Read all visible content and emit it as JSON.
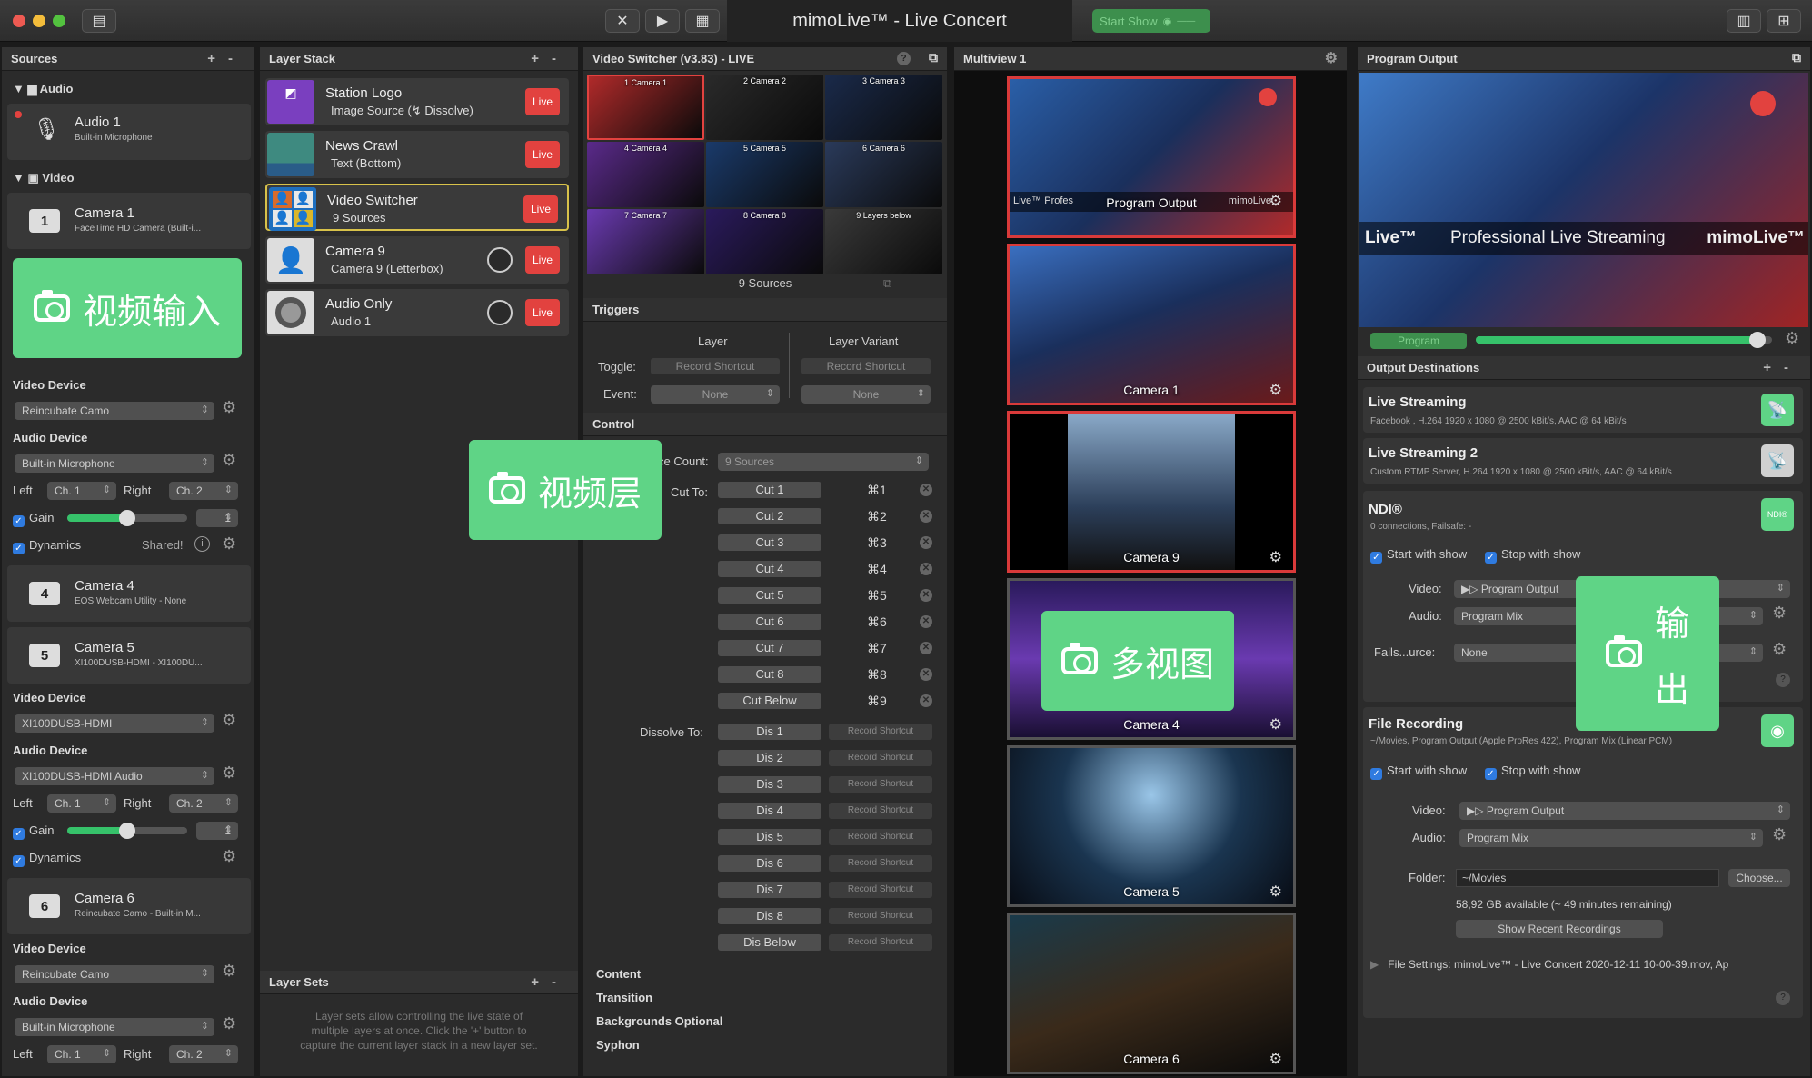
{
  "window": {
    "title": "mimoLive™ - Live Concert",
    "start_show": "Start Show"
  },
  "colors": {
    "live_red": "#e2423f",
    "green_accent": "#5fd486",
    "panel_bg": "#2b2b2b"
  },
  "sources": {
    "title": "Sources",
    "add": "+",
    "remove": "-",
    "audio_group": "Audio",
    "video_group": "Video",
    "audio1": {
      "name": "Audio 1",
      "sub": "Built-in Microphone"
    },
    "camera1": {
      "num": "1",
      "name": "Camera 1",
      "sub": "FaceTime HD Camera (Built-i..."
    },
    "camera4": {
      "num": "4",
      "name": "Camera 4",
      "sub": "EOS Webcam Utility - None"
    },
    "camera5": {
      "num": "5",
      "name": "Camera 5",
      "sub": "XI100DUSB-HDMI - XI100DU..."
    },
    "camera6": {
      "num": "6",
      "name": "Camera 6",
      "sub": "Reincubate Camo - Built-in M..."
    },
    "video_device_label": "Video Device",
    "audio_device_label": "Audio Device",
    "block1": {
      "video_device": "Reincubate Camo",
      "audio_device": "Built-in Microphone",
      "left": "Left",
      "left_ch": "Ch. 1",
      "right": "Right",
      "right_ch": "Ch. 2",
      "gain": "Gain",
      "gain_value": "1",
      "gain_level": 0.5,
      "dynamics": "Dynamics",
      "shared": "Shared!"
    },
    "block2": {
      "video_device": "XI100DUSB-HDMI",
      "audio_device": "XI100DUSB-HDMI Audio",
      "left": "Left",
      "left_ch": "Ch. 1",
      "right": "Right",
      "right_ch": "Ch. 2",
      "gain": "Gain",
      "gain_value": "1",
      "gain_level": 0.5,
      "dynamics": "Dynamics"
    },
    "block3": {
      "video_device": "Reincubate Camo",
      "audio_device": "Built-in Microphone",
      "left": "Left",
      "left_ch": "Ch. 1",
      "right": "Right",
      "right_ch": "Ch. 2"
    }
  },
  "overlays": {
    "video_input": "视频输入",
    "video_layer": "视频层",
    "multiview": "多视图",
    "output_1": "输",
    "output_2": "出"
  },
  "layer_stack": {
    "title": "Layer Stack",
    "add": "+",
    "remove": "-",
    "layers": [
      {
        "name": "Station Logo",
        "sub": "Image Source (↯ Dissolve)",
        "live": "Live"
      },
      {
        "name": "News Crawl",
        "sub": "Text (Bottom)",
        "live": "Live"
      },
      {
        "name": "Video Switcher",
        "sub": "9 Sources",
        "live": "Live"
      },
      {
        "name": "Camera 9",
        "sub": "Camera 9 (Letterbox)",
        "live": "Live"
      },
      {
        "name": "Audio Only",
        "sub": "Audio 1",
        "live": "Live"
      }
    ],
    "layer_sets_title": "Layer Sets",
    "layer_sets_help": "Layer sets allow controlling the live state of multiple layers at once. Click the '+' button to capture the current layer stack in a new layer set."
  },
  "switcher": {
    "title": "Video Switcher (v3.83) - LIVE",
    "cams": [
      "1 Camera 1",
      "2 Camera 2",
      "3 Camera 3",
      "4 Camera 4",
      "5 Camera 5",
      "6 Camera 6",
      "7 Camera 7",
      "8 Camera 8",
      "9 Layers below"
    ],
    "sources_count": "9 Sources",
    "triggers": "Triggers",
    "layer_col": "Layer",
    "variant_col": "Layer Variant",
    "toggle": "Toggle:",
    "event": "Event:",
    "record_shortcut": "Record Shortcut",
    "none": "None",
    "control": "Control",
    "source_count_label": "ce Count:",
    "source_count_value": "9 Sources",
    "cut_to": "Cut To:",
    "dissolve_to": "Dissolve To:",
    "cuts": [
      {
        "label": "Cut 1",
        "key": "⌘1"
      },
      {
        "label": "Cut 2",
        "key": "⌘2"
      },
      {
        "label": "Cut 3",
        "key": "⌘3"
      },
      {
        "label": "Cut 4",
        "key": "⌘4"
      },
      {
        "label": "Cut 5",
        "key": "⌘5"
      },
      {
        "label": "Cut 6",
        "key": "⌘6"
      },
      {
        "label": "Cut 7",
        "key": "⌘7"
      },
      {
        "label": "Cut 8",
        "key": "⌘8"
      },
      {
        "label": "Cut Below",
        "key": "⌘9"
      }
    ],
    "dissolves": [
      "Dis 1",
      "Dis 2",
      "Dis 3",
      "Dis 4",
      "Dis 5",
      "Dis 6",
      "Dis 7",
      "Dis 8",
      "Dis Below"
    ],
    "bottom": [
      "Content",
      "Transition",
      "Backgrounds Optional",
      "Syphon"
    ]
  },
  "multiview": {
    "title": "Multiview 1",
    "tiles": [
      "Program Output",
      "Camera 1",
      "Camera 9",
      "Camera 4",
      "Camera 5",
      "Camera 6"
    ],
    "ticker": "Live™   Profes",
    "ticker_right": "mimoLive"
  },
  "program": {
    "title": "Program Output",
    "ticker_left": "Live™",
    "ticker_mid": "Professional Live Streaming",
    "ticker_right": "mimoLive™",
    "program_btn": "Program",
    "program_level": 0.95,
    "dest_title": "Output Destinations",
    "live1": {
      "title": "Live Streaming",
      "sub": "Facebook                                         , H.264 1920 x 1080 @ 2500 kBit/s, AAC @ 64 kBit/s"
    },
    "live2": {
      "title": "Live Streaming 2",
      "sub": "Custom RTMP Server, H.264 1920 x 1080 @ 2500 kBit/s, AAC @ 64 kBit/s"
    },
    "ndi": {
      "title": "NDI®",
      "sub": "0 connections, Failsafe: -",
      "btn": "NDI®",
      "start": "Start with show",
      "stop": "Stop with show",
      "video_label": "Video:",
      "video": "Program Output",
      "audio_label": "Audio:",
      "audio": "Program Mix",
      "failsafe_label": "Fails...urce:",
      "failsafe": "None"
    },
    "file": {
      "title": "File Recording",
      "sub": "~/Movies, Program Output (Apple ProRes 422), Program Mix (Linear PCM)",
      "start": "Start with show",
      "stop": "Stop with show",
      "video_label": "Video:",
      "video": "Program Output",
      "audio_label": "Audio:",
      "audio": "Program Mix",
      "folder_label": "Folder:",
      "folder": "~/Movies",
      "choose": "Choose...",
      "available": "58,92 GB available (~ 49 minutes remaining)",
      "show_recent": "Show Recent Recordings",
      "settings": "File Settings: mimoLive™ - Live Concert 2020-12-11 10-00-39.mov, Ap"
    }
  }
}
